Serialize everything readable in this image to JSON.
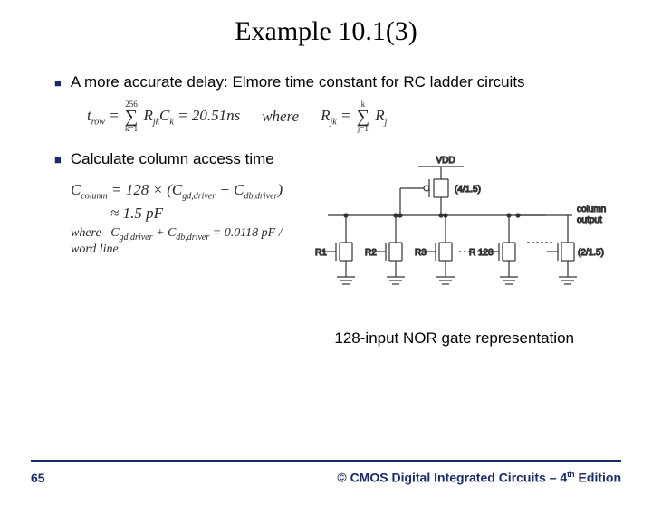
{
  "title": "Example 10.1(3)",
  "bullets": {
    "b1": "A more accurate delay: Elmore time constant for RC ladder circuits",
    "b2": "Calculate column access time"
  },
  "formula1": {
    "lhs": "t",
    "lhs_sub": "row",
    "sum_top": "256",
    "sum_bot": "k=1",
    "term1": "R",
    "term1_sub": "jk",
    "term2": "C",
    "term2_sub": "k",
    "eq_val": " = 20.51ns",
    "where": "where",
    "rhs": "R",
    "rhs_sub": "jk",
    "sum2_top": "k",
    "sum2_bot": "j=1",
    "rhs2": "R",
    "rhs2_sub": "j"
  },
  "formula2": {
    "line1_lhs": "C",
    "line1_sub": "column",
    "line1_rhs": " = 128 × (C",
    "line1_s1": "gd,driver",
    "line1_mid": " + C",
    "line1_s2": "db,driver",
    "line1_end": ")",
    "line2": "≈ 1.5 pF"
  },
  "formula3": {
    "where": "where",
    "body1": "C",
    "s1": "gd,driver",
    "mid": " + C",
    "s2": "db,driver",
    "eq": " = 0.0118 pF / word line"
  },
  "circuit": {
    "vdd": "VDD",
    "pmos_size": "(4/1.5)",
    "out": "column\noutput",
    "r1": "R1",
    "r2": "R2",
    "r3": "R3",
    "r128": "R 128",
    "nmos_size": "(2/1.5)"
  },
  "caption": "128-input NOR gate representation",
  "footer": {
    "page": "65",
    "copy_pre": "© CMOS Digital Integrated Circuits – 4",
    "copy_ed": "th",
    "copy_post": " Edition"
  }
}
